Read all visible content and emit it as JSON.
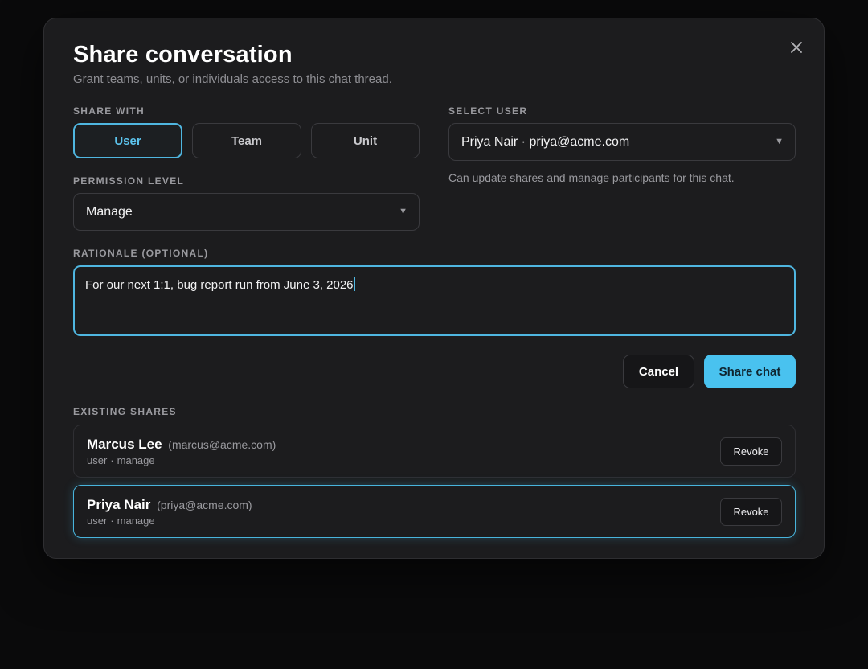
{
  "dialog": {
    "title": "Share conversation",
    "subtitle": "Grant teams, units, or individuals access to this chat thread.",
    "close_icon": "close-icon"
  },
  "share_with": {
    "label": "SHARE WITH",
    "options": [
      "User",
      "Team",
      "Unit"
    ],
    "selected": "User"
  },
  "select_user": {
    "label": "SELECT USER",
    "value": "Priya Nair · priya@acme.com",
    "helper": "Can update shares and manage participants for this chat."
  },
  "permission": {
    "label": "PERMISSION LEVEL",
    "value": "Manage"
  },
  "rationale": {
    "label": "RATIONALE (OPTIONAL)",
    "value": "For our next 1:1, bug report run from June 3, 2026"
  },
  "actions": {
    "cancel": "Cancel",
    "share": "Share chat"
  },
  "existing": {
    "label": "EXISTING SHARES",
    "items": [
      {
        "name": "Marcus Lee",
        "email": "(marcus@acme.com)",
        "type": "user",
        "level": "manage",
        "revoke": "Revoke"
      },
      {
        "name": "Priya Nair",
        "email": "(priya@acme.com)",
        "type": "user",
        "level": "manage",
        "revoke": "Revoke"
      }
    ]
  },
  "colors": {
    "accent": "#49c2ef",
    "background": "#0a0a0b",
    "panel": "#1c1c1e"
  }
}
